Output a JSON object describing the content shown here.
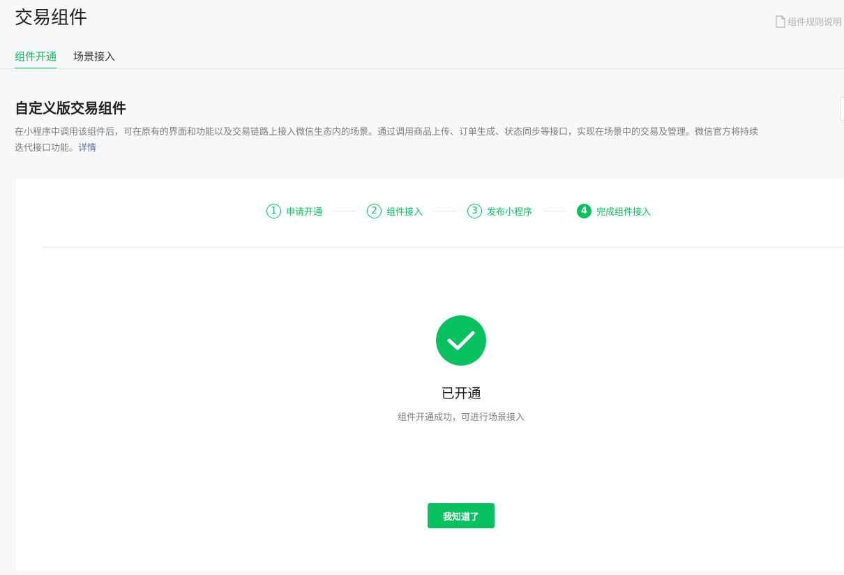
{
  "header": {
    "title": "交易组件",
    "rules_link": "组件规则说明",
    "tabs": [
      {
        "label": "组件开通",
        "active": true
      },
      {
        "label": "场景接入",
        "active": false
      }
    ]
  },
  "section": {
    "title": "自定义版交易组件",
    "description": "在小程序中调用该组件后，可在原有的界面和功能以及交易链路上接入微信生态内的场景。通过调用商品上传、订单生成、状态同步等接口，实现在场景中的交易及管理。微信官方将持续迭代接口功能。",
    "details_link": "详情"
  },
  "steps": [
    {
      "number": "1",
      "label": "申请开通"
    },
    {
      "number": "2",
      "label": "组件接入"
    },
    {
      "number": "3",
      "label": "发布小程序"
    },
    {
      "number": "4",
      "label": "完成组件接入",
      "current": true
    }
  ],
  "result": {
    "icon": "check-circle-icon",
    "title": "已开通",
    "description": "组件开通成功，可进行场景接入",
    "button_label": "我知道了"
  },
  "colors": {
    "brand_green": "#07c160",
    "link_blue": "#576b95",
    "page_background": "#f7f8fa"
  }
}
